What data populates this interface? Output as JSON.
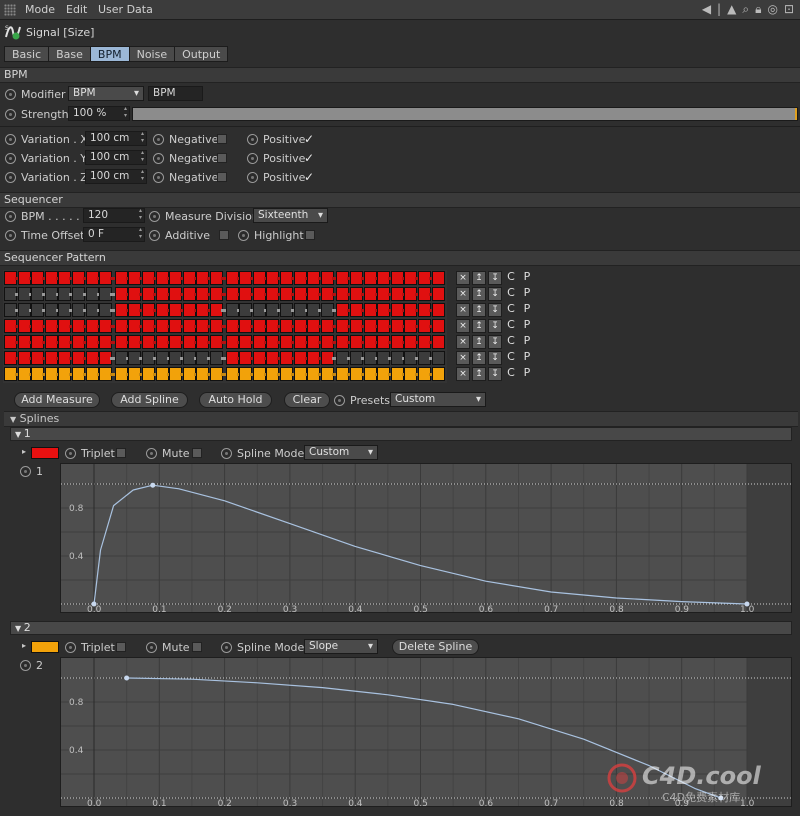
{
  "menu": {
    "items": [
      "Mode",
      "Edit",
      "User Data"
    ]
  },
  "object": {
    "title": "Signal [Size]"
  },
  "tabs": [
    "Basic",
    "Base",
    "BPM",
    "Noise",
    "Output"
  ],
  "active_tab": "BPM",
  "sections": {
    "bpm": "BPM",
    "sequencer": "Sequencer",
    "pattern": "Sequencer Pattern",
    "splines": "Splines"
  },
  "bpm_section": {
    "modifier_label": "Modifier",
    "modifier_value": "BPM",
    "modifier_name": "BPM",
    "strength_label": "Strength",
    "strength_value": "100 %",
    "strength_fraction": 1.0
  },
  "variation": [
    {
      "label": "Variation . X",
      "value": "100 cm",
      "negative": "Negative",
      "negative_checked": false,
      "positive": "Positive",
      "positive_checked": true
    },
    {
      "label": "Variation . Y",
      "value": "100 cm",
      "negative": "Negative",
      "negative_checked": false,
      "positive": "Positive",
      "positive_checked": true
    },
    {
      "label": "Variation . Z",
      "value": "100 cm",
      "negative": "Negative",
      "negative_checked": false,
      "positive": "Positive",
      "positive_checked": true
    }
  ],
  "sequencer": {
    "bpm_label": "BPM . . . . . .",
    "bpm_value": "120",
    "measure_label": "Measure Division",
    "measure_value": "Sixteenth",
    "offset_label": "Time Offset",
    "offset_value": "0 F",
    "additive_label": "Additive",
    "highlight_label": "Highlight"
  },
  "pattern": {
    "row_controls": [
      "×",
      "↥",
      "↧",
      "C",
      "P"
    ],
    "rows": [
      {
        "color": "red",
        "steps": "1111111111111111111111111111111111111111111111111111111111111111"
      },
      {
        "color": "red",
        "steps": "0000000011111111111111111111111100000000000000000000000000000000"
      },
      {
        "color": "red",
        "steps": "0000000011111111000000001111111100000000000000000000000000000000"
      },
      {
        "color": "red",
        "steps": "1111111111111111111111111111111111111111111111111111111111111111"
      },
      {
        "color": "red",
        "steps": "1111111111111111111111111111111111111111111111111111111111111111"
      },
      {
        "color": "red",
        "steps": "1111111100000000111111110000000011111111000000000000000000000000"
      },
      {
        "color": "orange",
        "steps": "1111111111111111111111111111111111111111111111111111111111111111"
      }
    ]
  },
  "buttons": {
    "add_measure": "Add Measure",
    "add_spline": "Add Spline",
    "auto_hold": "Auto Hold",
    "clear": "Clear",
    "presets_label": "Presets",
    "presets_value": "Custom"
  },
  "splines": [
    {
      "index": "1",
      "color": "#e81010",
      "triplet": "Triplet",
      "mute": "Mute",
      "mode_label": "Spline Mode",
      "mode_value": "Custom",
      "delete_label": "",
      "curve_label": "1",
      "y_ticks": [
        "0.8",
        "0.4"
      ],
      "x_ticks": [
        "0.0",
        "0.1",
        "0.2",
        "0.3",
        "0.4",
        "0.5",
        "0.6",
        "0.7",
        "0.8",
        "0.9",
        "1.0"
      ],
      "points": [
        [
          0.0,
          0.0
        ],
        [
          0.01,
          0.45
        ],
        [
          0.03,
          0.82
        ],
        [
          0.06,
          0.95
        ],
        [
          0.09,
          0.99
        ],
        [
          0.13,
          0.96
        ],
        [
          0.2,
          0.86
        ],
        [
          0.3,
          0.67
        ],
        [
          0.4,
          0.48
        ],
        [
          0.5,
          0.32
        ],
        [
          0.6,
          0.19
        ],
        [
          0.7,
          0.1
        ],
        [
          0.8,
          0.05
        ],
        [
          0.9,
          0.02
        ],
        [
          1.0,
          0.0
        ]
      ],
      "keys": [
        [
          0.0,
          0.0
        ],
        [
          0.09,
          0.99
        ],
        [
          1.0,
          0.0
        ]
      ]
    },
    {
      "index": "2",
      "color": "#f2a20a",
      "triplet": "Triplet",
      "mute": "Mute",
      "mode_label": "Spline Mode",
      "mode_value": "Slope",
      "delete_label": "Delete Spline",
      "curve_label": "2",
      "y_ticks": [
        "0.8",
        "0.4"
      ],
      "x_ticks": [
        "0.0",
        "0.1",
        "0.2",
        "0.3",
        "0.4",
        "0.5",
        "0.6",
        "0.7",
        "0.8",
        "0.9",
        "1.0"
      ],
      "points": [
        [
          0.05,
          1.0
        ],
        [
          0.15,
          0.99
        ],
        [
          0.25,
          0.96
        ],
        [
          0.35,
          0.92
        ],
        [
          0.45,
          0.86
        ],
        [
          0.55,
          0.78
        ],
        [
          0.65,
          0.66
        ],
        [
          0.75,
          0.49
        ],
        [
          0.85,
          0.27
        ],
        [
          0.92,
          0.08
        ],
        [
          0.96,
          0.0
        ]
      ],
      "keys": [
        [
          0.05,
          1.0
        ],
        [
          0.96,
          0.0
        ]
      ]
    }
  ],
  "watermark": {
    "brand": "C4D.cool",
    "sub": "C4D免费素材库"
  },
  "colors": {
    "accent_tab": "#9bb7d6",
    "red": "#e01010",
    "orange": "#f2a20a",
    "curve": "#a9c2e0"
  }
}
